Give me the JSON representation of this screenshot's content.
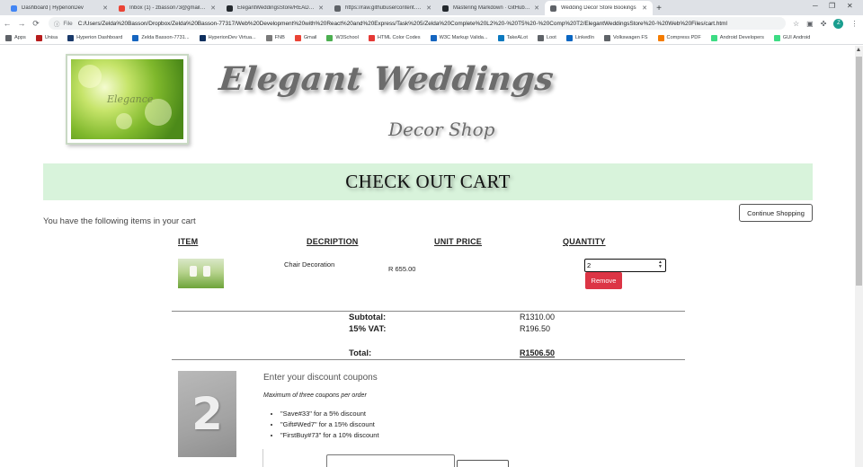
{
  "browser": {
    "tabs": [
      {
        "title": "Dashboard | HyperionDev",
        "color": "#4285f4",
        "active": false
      },
      {
        "title": "Inbox (1) - zbasson73@gmail.com",
        "color": "#ea4335",
        "active": false
      },
      {
        "title": "ElegantWeddingsStore/README.md",
        "color": "#24292e",
        "active": false
      },
      {
        "title": "https://raw.githubusercontent.com",
        "color": "#5f6368",
        "active": false
      },
      {
        "title": "Mastering Markdown · GitHub Guides",
        "color": "#24292e",
        "active": false
      },
      {
        "title": "Wedding Decor Store Bookings",
        "color": "#5f6368",
        "active": true
      }
    ],
    "address": {
      "scheme": "File",
      "url": "C:/Users/Zelda%20Basson/Dropbox/Zelda%20Basson-77317/Web%20Development%20with%20React%20and%20Express/Task%205/Zelda%20Complete%20L2%20-%20T5%20-%20Comp%20T2/ElegantWeddingsStore%20-%20Web%20Files/cart.html"
    },
    "profile_initial": "Z",
    "bookmarks": [
      {
        "label": "Apps",
        "color": "#5f6368"
      },
      {
        "label": "Unisa",
        "color": "#b71c1c"
      },
      {
        "label": "Hyperion Dashboard",
        "color": "#1a3a6b"
      },
      {
        "label": "Zelda Basson-7731...",
        "color": "#1565c0"
      },
      {
        "label": "HyperionDev Virtua...",
        "color": "#0d2f5e"
      },
      {
        "label": "FNB",
        "color": "#7a7a7a"
      },
      {
        "label": "Gmail",
        "color": "#ea4335"
      },
      {
        "label": "W3School",
        "color": "#4caf50"
      },
      {
        "label": "HTML Color Codes",
        "color": "#e53935"
      },
      {
        "label": "W3C Markup Valida...",
        "color": "#1565c0"
      },
      {
        "label": "TakeALot",
        "color": "#0b79bf"
      },
      {
        "label": "Loot",
        "color": "#5f6368"
      },
      {
        "label": "LinkedIn",
        "color": "#0a66c2"
      },
      {
        "label": "Volkswagen FS",
        "color": "#5f6368"
      },
      {
        "label": "Compress PDF",
        "color": "#f57c00"
      },
      {
        "label": "Android Developers",
        "color": "#3ddc84"
      },
      {
        "label": "GUI Android",
        "color": "#3ddc84"
      }
    ]
  },
  "header": {
    "logo_text": "Elegance",
    "title": "Elegant Weddings",
    "subtitle": "Decor Shop"
  },
  "cart": {
    "heading": "CHECK OUT CART",
    "continue_label": "Continue Shopping",
    "intro": "You have the following items in your cart",
    "columns": {
      "item": "ITEM",
      "description": "DECRIPTION",
      "unit_price": "UNIT PRICE",
      "quantity": "QUANTITY"
    },
    "items": [
      {
        "description": "Chair Decoration",
        "unit_price": "R 655.00",
        "quantity": "2",
        "remove_label": "Remove"
      }
    ],
    "totals": {
      "subtotal_label": "Subtotal:",
      "subtotal": "R1310.00",
      "vat_label": "15% VAT:",
      "vat": "R196.50",
      "total_label": "Total:",
      "total": "R1506.50"
    }
  },
  "coupons": {
    "image_digit": "2",
    "heading": "Enter your discount coupons",
    "subheading": "Maximum of three coupons per order",
    "list": [
      "\"Save#33\" for a 5% discount",
      "\"Gift#Wed7\" for a 15% discount",
      "\"FirstBuy#73\" for a 10% discount"
    ]
  },
  "colors": {
    "banner": "#d8f3db",
    "remove": "#dc3545"
  }
}
